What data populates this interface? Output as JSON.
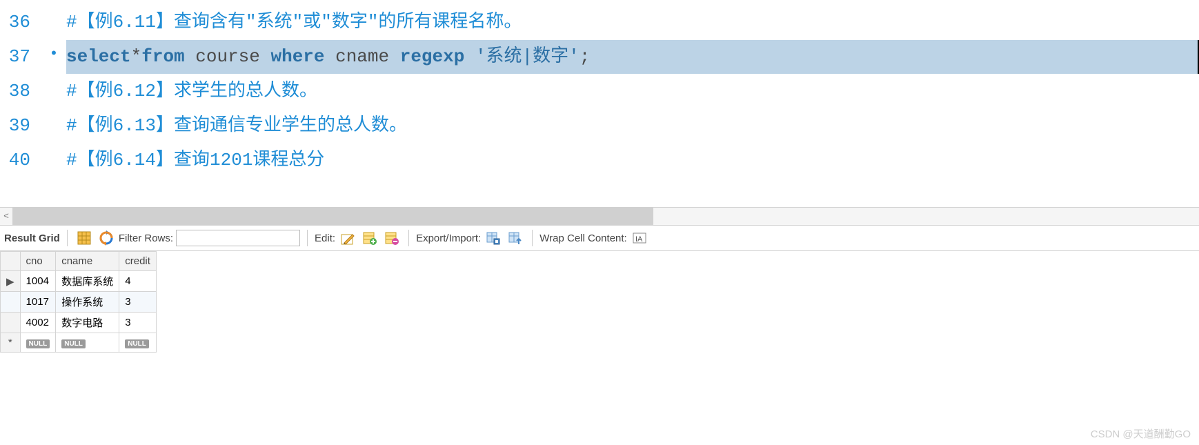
{
  "editor": {
    "lines": [
      {
        "num": "36",
        "bullet": "",
        "tokens": [
          {
            "cls": "comment",
            "t": "#【例6.11】查询含有\"系统\"或\"数字\"的所有课程名称。"
          }
        ]
      },
      {
        "num": "37",
        "bullet": "•",
        "highlighted": true,
        "tokens": [
          {
            "cls": "kw",
            "t": "select"
          },
          {
            "cls": "ident",
            "t": "*"
          },
          {
            "cls": "kw",
            "t": "from"
          },
          {
            "cls": "ident",
            "t": " course "
          },
          {
            "cls": "kw",
            "t": "where"
          },
          {
            "cls": "ident",
            "t": " cname "
          },
          {
            "cls": "kw",
            "t": "regexp"
          },
          {
            "cls": "ident",
            "t": " "
          },
          {
            "cls": "str",
            "t": "'系统|数字'"
          },
          {
            "cls": "ident",
            "t": ";"
          }
        ]
      },
      {
        "num": "38",
        "bullet": "",
        "tokens": [
          {
            "cls": "comment",
            "t": "#【例6.12】求学生的总人数。"
          }
        ]
      },
      {
        "num": "39",
        "bullet": "",
        "tokens": [
          {
            "cls": "comment",
            "t": "#【例6.13】查询通信专业学生的总人数。"
          }
        ]
      },
      {
        "num": "40",
        "bullet": "",
        "tokens": [
          {
            "cls": "comment",
            "t": "#【例6.14】查询1201课程总分"
          }
        ]
      }
    ]
  },
  "toolbar": {
    "result_grid": "Result Grid",
    "filter_rows": "Filter Rows:",
    "filter_value": "",
    "edit": "Edit:",
    "export_import": "Export/Import:",
    "wrap_cell": "Wrap Cell Content:"
  },
  "grid": {
    "columns": [
      "cno",
      "cname",
      "credit"
    ],
    "rows": [
      {
        "marker": "▶",
        "cno": "1004",
        "cname": "数据库系统",
        "credit": "4",
        "sel": false
      },
      {
        "marker": "",
        "cno": "1017",
        "cname": "操作系统",
        "credit": "3",
        "sel": true
      },
      {
        "marker": "",
        "cno": "4002",
        "cname": "数字电路",
        "credit": "3",
        "sel": false
      }
    ],
    "null_row_marker": "*",
    "null_label": "NULL"
  },
  "watermark": "CSDN @天道酬勤GO"
}
